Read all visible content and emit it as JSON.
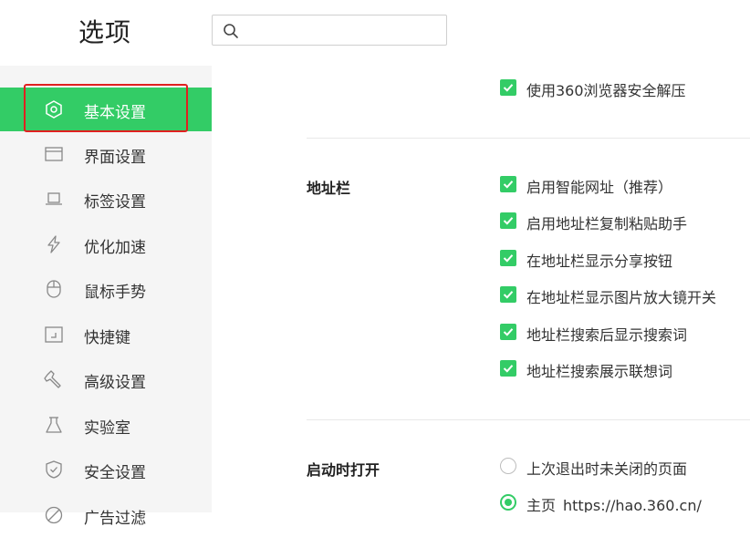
{
  "header": {
    "title": "选项",
    "search_placeholder": ""
  },
  "sidebar": {
    "items": [
      {
        "label": "基本设置",
        "icon": "gear-icon",
        "active": true
      },
      {
        "label": "界面设置",
        "icon": "window-icon"
      },
      {
        "label": "标签设置",
        "icon": "tab-icon"
      },
      {
        "label": "优化加速",
        "icon": "lightning-icon"
      },
      {
        "label": "鼠标手势",
        "icon": "mouse-icon"
      },
      {
        "label": "快捷键",
        "icon": "keyboard-icon"
      },
      {
        "label": "高级设置",
        "icon": "wrench-icon"
      },
      {
        "label": "实验室",
        "icon": "flask-icon"
      },
      {
        "label": "安全设置",
        "icon": "shield-icon"
      },
      {
        "label": "广告过滤",
        "icon": "block-icon"
      }
    ]
  },
  "content": {
    "top_option": {
      "label": "使用360浏览器安全解压",
      "checked": true
    },
    "address_bar": {
      "title": "地址栏",
      "options": [
        {
          "label": "启用智能网址（推荐）",
          "checked": true
        },
        {
          "label": "启用地址栏复制粘贴助手",
          "checked": true
        },
        {
          "label": "在地址栏显示分享按钮",
          "checked": true
        },
        {
          "label": "在地址栏显示图片放大镜开关",
          "checked": true
        },
        {
          "label": "地址栏搜索后显示搜索词",
          "checked": true
        },
        {
          "label": "地址栏搜索展示联想词",
          "checked": true
        }
      ]
    },
    "startup": {
      "title": "启动时打开",
      "options": [
        {
          "label": "上次退出时未关闭的页面",
          "selected": false
        },
        {
          "label": "主页",
          "url": "https://hao.360.cn/",
          "selected": true
        }
      ]
    }
  },
  "colors": {
    "accent": "#33cc66",
    "focus_outline": "#e02020",
    "sidebar_bg": "#f5f5f5"
  }
}
